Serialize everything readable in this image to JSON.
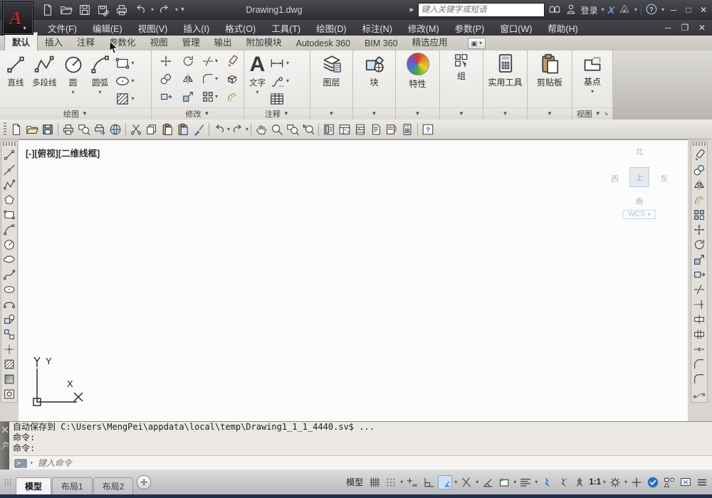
{
  "title_bar": {
    "app_title": "Drawing1.dwg",
    "search_placeholder": "键入关键字或短语",
    "sign_in_label": "登录"
  },
  "menu": {
    "items": [
      "文件(F)",
      "编辑(E)",
      "视图(V)",
      "插入(I)",
      "格式(O)",
      "工具(T)",
      "绘图(D)",
      "标注(N)",
      "修改(M)",
      "参数(P)",
      "窗口(W)",
      "帮助(H)"
    ]
  },
  "ribbon": {
    "tabs": [
      "默认",
      "插入",
      "注释",
      "参数化",
      "视图",
      "管理",
      "输出",
      "附加模块",
      "Autodesk 360",
      "BIM 360",
      "精选应用"
    ],
    "draw": {
      "footer": "绘图",
      "tools": [
        "直线",
        "多段线",
        "圆",
        "圆弧"
      ]
    },
    "modify": {
      "footer": "修改"
    },
    "annotate": {
      "footer": "注释",
      "text_label": "文字"
    },
    "layers": {
      "label": "图层"
    },
    "block": {
      "label": "块"
    },
    "properties": {
      "label": "特性"
    },
    "group": {
      "label": "组"
    },
    "utilities": {
      "label": "实用工具"
    },
    "clipboard": {
      "label": "剪贴板"
    },
    "view": {
      "footer": "视图",
      "base_label": "基点"
    }
  },
  "viewport": {
    "label": "[-][俯视][二维线框]",
    "viewcube": {
      "north": "北",
      "south": "南",
      "east": "东",
      "west": "西",
      "top": "上",
      "wcs": "WCS"
    },
    "ucs": {
      "x_label": "X",
      "y_label": "Y"
    }
  },
  "command": {
    "lines": [
      "自动保存到 C:\\Users\\MengPei\\appdata\\local\\temp\\Drawing1_1_1_4440.sv$ ...",
      "命令:",
      "命令:"
    ],
    "input_placeholder": "键入命令"
  },
  "status": {
    "tabs": [
      "模型",
      "布局1",
      "布局2"
    ],
    "space_label": "模型",
    "scale": "1:1"
  }
}
